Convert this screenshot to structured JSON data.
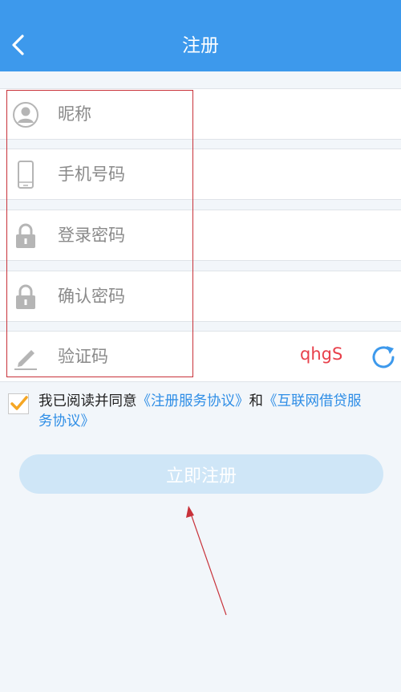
{
  "header": {
    "title": "注册"
  },
  "form": {
    "nickname_placeholder": "昵称",
    "phone_placeholder": "手机号码",
    "password_placeholder": "登录密码",
    "confirm_placeholder": "确认密码",
    "captcha_placeholder": "验证码",
    "captcha_code": "qhgS"
  },
  "agreement": {
    "prefix": "我已阅读并同意",
    "link1": "《注册服务协议》",
    "middle": "和",
    "link2_part1": "《互联网借贷服",
    "link2_part2": "务协议》"
  },
  "register_button": "立即注册",
  "colors": {
    "header": "#3d99ec",
    "link": "#2f8ee6",
    "captcha": "#e8404b",
    "check": "#f5a623",
    "button_disabled": "#cfe6f7",
    "annotation": "#c8323a"
  }
}
